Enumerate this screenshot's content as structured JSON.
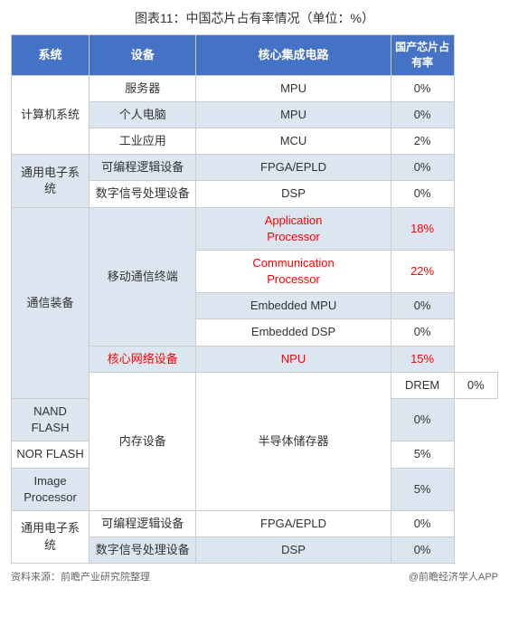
{
  "title": "图表11：中国芯片占有率情况（单位：%）",
  "headers": [
    "系统",
    "设备",
    "核心集成电路",
    "国产芯片占有率"
  ],
  "rows": [
    {
      "system": "计算机系统",
      "system_rowspan": 3,
      "device": "服务器",
      "device_rowspan": 1,
      "core": "MPU",
      "core_red": false,
      "rate": "0%",
      "rate_red": false
    },
    {
      "device": "个人电脑",
      "device_rowspan": 1,
      "core": "MPU",
      "core_red": false,
      "rate": "0%",
      "rate_red": false
    },
    {
      "device": "工业应用",
      "device_rowspan": 1,
      "core": "MCU",
      "core_red": false,
      "rate": "2%",
      "rate_red": false
    },
    {
      "system": "通用电子系统",
      "system_rowspan": 2,
      "device": "可编程逻辑设备",
      "device_rowspan": 1,
      "core": "FPGA/EPLD",
      "core_red": false,
      "rate": "0%",
      "rate_red": false
    },
    {
      "device": "数字信号处理设备",
      "device_rowspan": 1,
      "core": "DSP",
      "core_red": false,
      "rate": "0%",
      "rate_red": false
    },
    {
      "system": "通信装备",
      "system_rowspan": 6,
      "device": "移动通信终端",
      "device_rowspan": 4,
      "core": "Application Processor",
      "core_red": true,
      "rate": "18%",
      "rate_red": true
    },
    {
      "core": "Communication Processor",
      "core_red": true,
      "rate": "22%",
      "rate_red": true
    },
    {
      "core": "Embedded MPU",
      "core_red": false,
      "rate": "0%",
      "rate_red": false
    },
    {
      "core": "Embedded DSP",
      "core_red": false,
      "rate": "0%",
      "rate_red": false
    },
    {
      "device": "核心网络设备",
      "device_red": true,
      "device_rowspan": 1,
      "core": "NPU",
      "core_red": true,
      "rate": "15%",
      "rate_red": true
    },
    {
      "system": "内存设备",
      "system_rowspan": 4,
      "device": "半导体储存器",
      "device_rowspan": 4,
      "core": "DREM",
      "core_red": false,
      "rate": "0%",
      "rate_red": false
    },
    {
      "core": "NAND FLASH",
      "core_red": false,
      "rate": "0%",
      "rate_red": false
    },
    {
      "core": "NOR FLASH",
      "core_red": false,
      "rate": "5%",
      "rate_red": false
    },
    {
      "core": "Image Processor",
      "core_red": false,
      "rate": "5%",
      "rate_red": false
    },
    {
      "system": "通用电子系统",
      "system_rowspan": 2,
      "device": "可编程逻辑设备",
      "device_rowspan": 1,
      "core": "FPGA/EPLD",
      "core_red": false,
      "rate": "0%",
      "rate_red": false
    },
    {
      "device": "数字信号处理设备",
      "device_rowspan": 1,
      "core": "DSP",
      "core_red": false,
      "rate": "0%",
      "rate_red": false
    }
  ],
  "footer_left": "资料来源：前瞻产业研究院整理",
  "footer_right": "@前瞻经济学人APP"
}
